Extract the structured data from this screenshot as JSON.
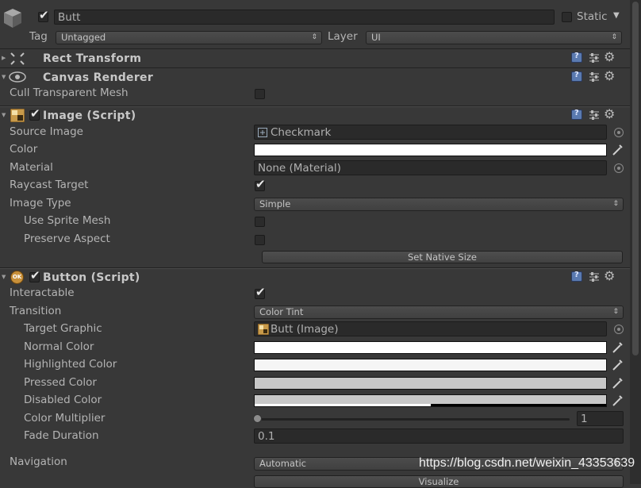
{
  "header": {
    "active": true,
    "name": "Butt",
    "static_label": "Static",
    "static_checked": false,
    "tag_label": "Tag",
    "tag_value": "Untagged",
    "layer_label": "Layer",
    "layer_value": "UI"
  },
  "components": {
    "rect_transform": {
      "title": "Rect Transform"
    },
    "canvas_renderer": {
      "title": "Canvas Renderer",
      "cull_label": "Cull Transparent Mesh",
      "cull_checked": false
    },
    "image": {
      "title": "Image (Script)",
      "enabled": true,
      "source_image_label": "Source Image",
      "source_image_value": "Checkmark",
      "color_label": "Color",
      "color_value": "#ffffff",
      "material_label": "Material",
      "material_value": "None (Material)",
      "raycast_label": "Raycast Target",
      "raycast_checked": true,
      "image_type_label": "Image Type",
      "image_type_value": "Simple",
      "use_sprite_mesh_label": "Use Sprite Mesh",
      "use_sprite_mesh_checked": false,
      "preserve_aspect_label": "Preserve Aspect",
      "preserve_aspect_checked": false,
      "set_native_size_label": "Set Native Size"
    },
    "button": {
      "title": "Button (Script)",
      "enabled": true,
      "icon_text": "OK",
      "interactable_label": "Interactable",
      "interactable_checked": true,
      "transition_label": "Transition",
      "transition_value": "Color Tint",
      "target_graphic_label": "Target Graphic",
      "target_graphic_value": "Butt (Image)",
      "normal_color_label": "Normal Color",
      "normal_color_value": "#ffffff",
      "highlighted_color_label": "Highlighted Color",
      "highlighted_color_value": "#f5f5f5",
      "pressed_color_label": "Pressed Color",
      "pressed_color_value": "#c8c8c8",
      "disabled_color_label": "Disabled Color",
      "disabled_color_value": "#c8c8c8",
      "disabled_alpha": 0.5,
      "color_multiplier_label": "Color Multiplier",
      "color_multiplier_value": "1",
      "fade_duration_label": "Fade Duration",
      "fade_duration_value": "0.1",
      "navigation_label": "Navigation",
      "navigation_value": "Automatic",
      "visualize_label": "Visualize"
    }
  },
  "watermark": "https://blog.csdn.net/weixin_43353639",
  "icons": {
    "gameobject": "cube-icon",
    "rect_transform": "rect-transform-icon",
    "canvas_renderer": "eye-icon",
    "image": "image-component-icon",
    "button": "button-component-icon",
    "help": "help-book-icon",
    "preset": "preset-sliders-icon",
    "settings": "gear-icon",
    "picker": "eyedropper-icon",
    "object_picker": "object-picker-icon",
    "sprite": "sprite-icon"
  }
}
